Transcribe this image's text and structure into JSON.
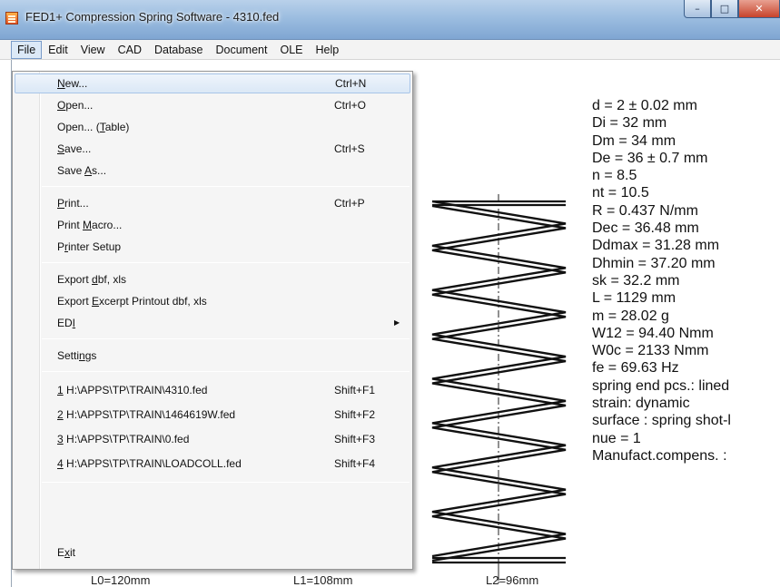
{
  "window": {
    "title": "FED1+  Compression Spring Software  - 4310.fed",
    "app_icon": "spring-app-icon",
    "controls": {
      "minimize": "–",
      "maximize": "□",
      "close": "✕"
    }
  },
  "menubar": [
    "File",
    "Edit",
    "View",
    "CAD",
    "Database",
    "Document",
    "OLE",
    "Help"
  ],
  "file_menu": [
    {
      "label": "New...",
      "shortcut": "Ctrl+N"
    },
    {
      "label": "Open...",
      "shortcut": "Ctrl+O"
    },
    {
      "label": "Open... (Table)",
      "shortcut": ""
    },
    {
      "label": "Save...",
      "shortcut": "Ctrl+S"
    },
    {
      "label": "Save As...",
      "shortcut": ""
    },
    {
      "label": "Print...",
      "shortcut": "Ctrl+P"
    },
    {
      "label": "Print Macro...",
      "shortcut": ""
    },
    {
      "label": "Printer Setup",
      "shortcut": ""
    },
    {
      "label": "Export dbf, xls",
      "shortcut": ""
    },
    {
      "label": "Export Excerpt Printout dbf, xls",
      "shortcut": ""
    },
    {
      "label": "EDI",
      "shortcut": "",
      "submenu_arrow": "▶"
    },
    {
      "label": "Settings",
      "shortcut": ""
    },
    {
      "label": "1 H:\\APPS\\TP\\TRAIN\\4310.fed",
      "shortcut": "Shift+F1"
    },
    {
      "label": "2 H:\\APPS\\TP\\TRAIN\\1464619W.fed",
      "shortcut": "Shift+F2"
    },
    {
      "label": "3 H:\\APPS\\TP\\TRAIN\\0.fed",
      "shortcut": "Shift+F3"
    },
    {
      "label": "4 H:\\APPS\\TP\\TRAIN\\LOADCOLL.fed",
      "shortcut": "Shift+F4"
    },
    {
      "label": "Exit",
      "shortcut": ""
    }
  ],
  "spring_properties": [
    "d = 2 ± 0.02 mm",
    "Di = 32 mm",
    "Dm = 34 mm",
    "De = 36 ± 0.7 mm",
    "n = 8.5",
    "nt = 10.5",
    "R = 0.437 N/mm",
    "Dec = 36.48 mm",
    "Ddmax = 31.28 mm",
    "Dhmin = 37.20 mm",
    "sk = 32.2 mm",
    "L = 1129 mm",
    "m = 28.02 g",
    "W12 = 94.40 Nmm",
    "W0c = 2133 Nmm",
    "fe = 69.63 Hz",
    "spring end pcs.: lined",
    "strain: dynamic",
    "surface : spring shot-l",
    "nue = 1",
    "Manufact.compens. :"
  ],
  "dimension_labels": [
    "L0=120mm",
    "L1=108mm",
    "L2=96mm"
  ]
}
